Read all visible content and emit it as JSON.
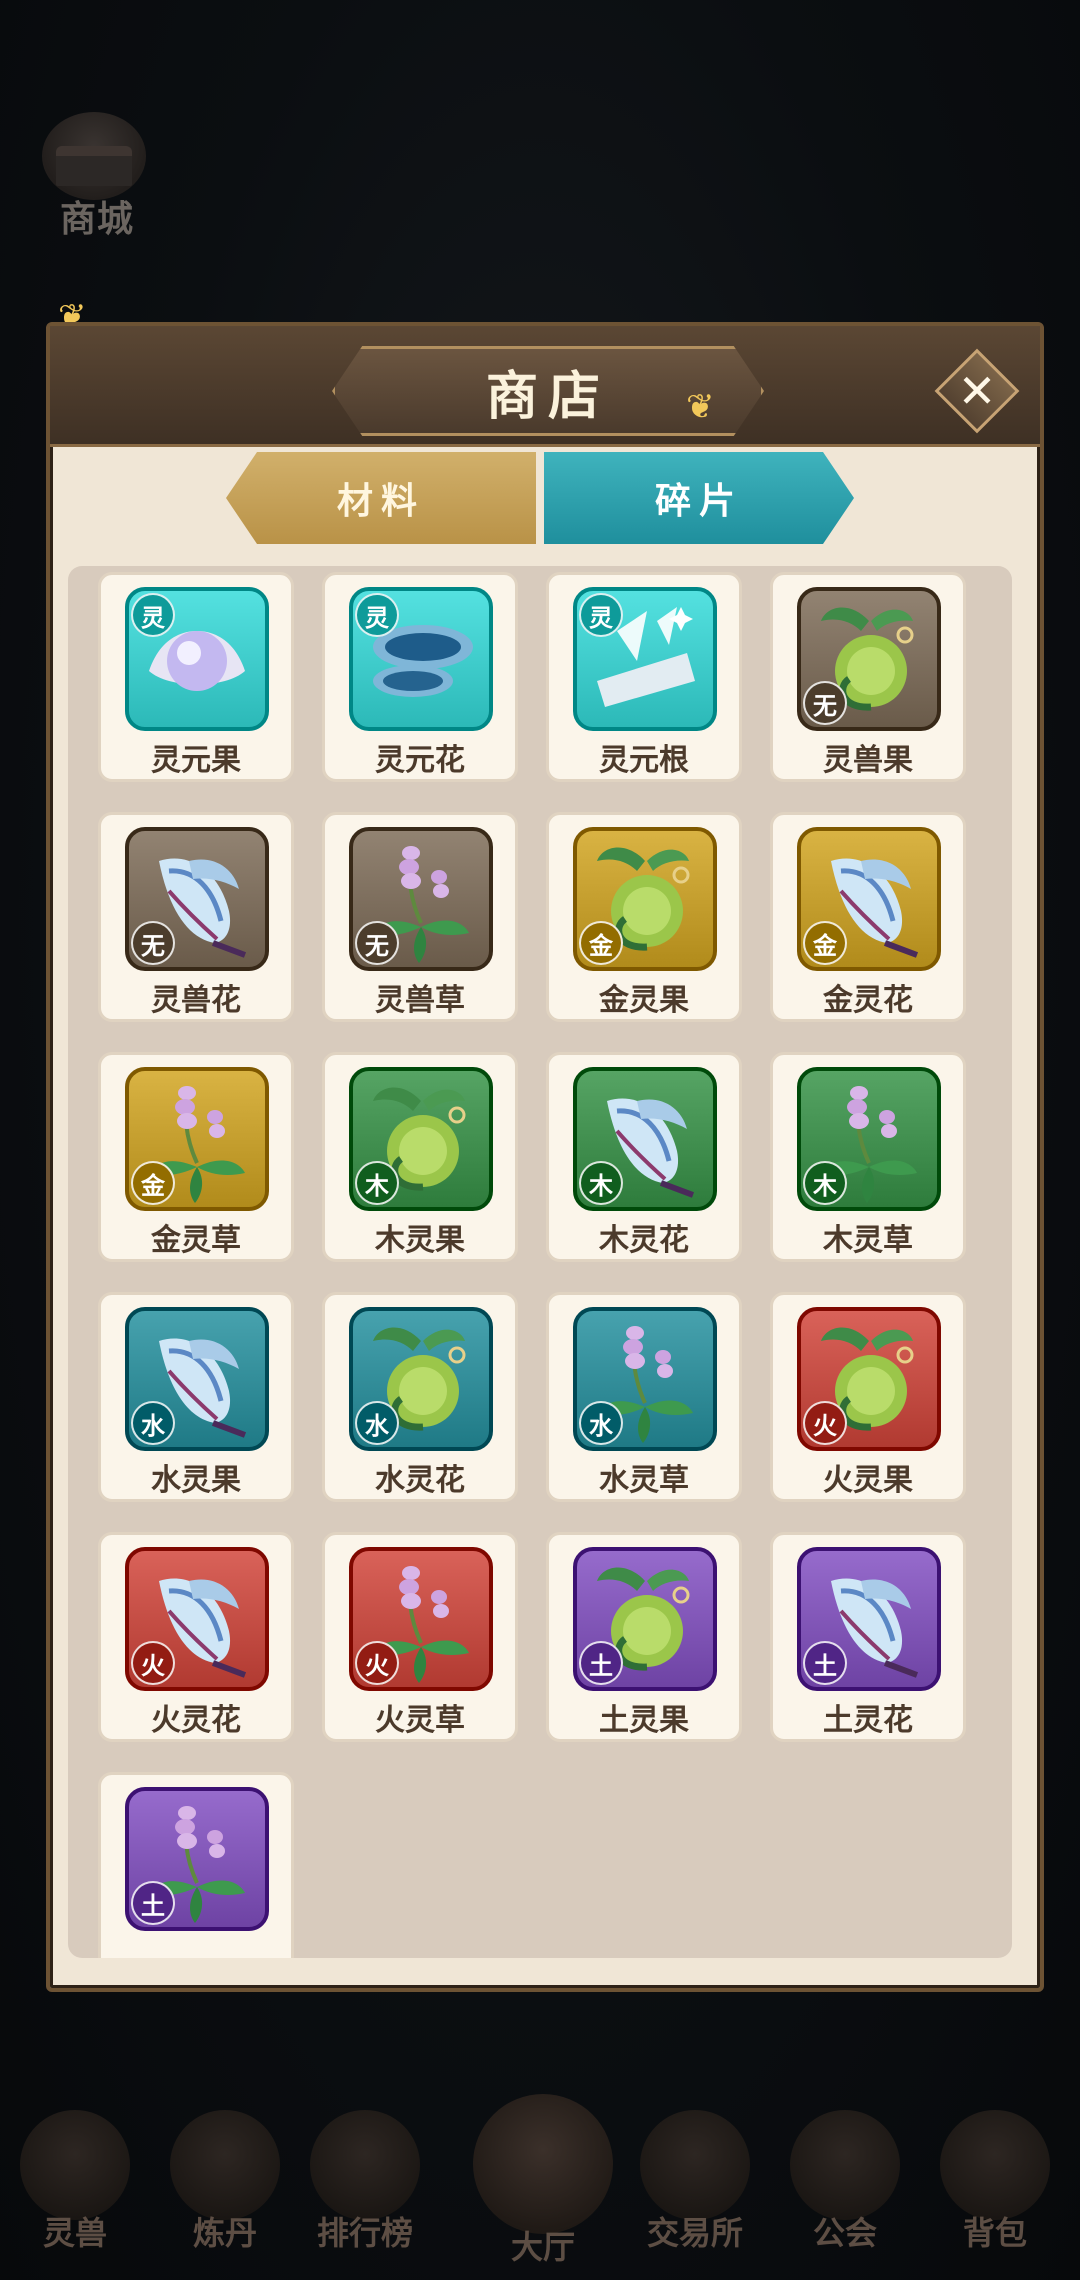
{
  "mall": {
    "label": "商城",
    "icon": "pavilion-icon"
  },
  "shop": {
    "title": "商店",
    "close_icon": "close-icon",
    "tabs": [
      {
        "label": "材料",
        "active": false
      },
      {
        "label": "碎片",
        "active": true
      }
    ]
  },
  "element_colors": {
    "灵": "#2cb9b8",
    "无": "#6a5b4a",
    "金": "#b18b1b",
    "木": "#2e7c3c",
    "水": "#1f7a86",
    "火": "#b13a31",
    "土": "#6e43a4"
  },
  "items": [
    {
      "name": "灵元果",
      "element": "灵",
      "badge_pos": "top",
      "icon": "spirit-pearl-icon"
    },
    {
      "name": "灵元花",
      "element": "灵",
      "badge_pos": "top",
      "icon": "lingzhi-mushroom-icon"
    },
    {
      "name": "灵元根",
      "element": "灵",
      "badge_pos": "top",
      "icon": "crystal-root-icon"
    },
    {
      "name": "灵兽果",
      "element": "无",
      "badge_pos": "bot",
      "icon": "spirit-fruit-icon"
    },
    {
      "name": "灵兽花",
      "element": "无",
      "badge_pos": "bot",
      "icon": "ice-flower-icon"
    },
    {
      "name": "灵兽草",
      "element": "无",
      "badge_pos": "bot",
      "icon": "lavender-herb-icon"
    },
    {
      "name": "金灵果",
      "element": "金",
      "badge_pos": "bot",
      "icon": "spirit-fruit-icon"
    },
    {
      "name": "金灵花",
      "element": "金",
      "badge_pos": "bot",
      "icon": "ice-flower-icon"
    },
    {
      "name": "金灵草",
      "element": "金",
      "badge_pos": "bot",
      "icon": "lavender-herb-icon"
    },
    {
      "name": "木灵果",
      "element": "木",
      "badge_pos": "bot",
      "icon": "spirit-fruit-icon"
    },
    {
      "name": "木灵花",
      "element": "木",
      "badge_pos": "bot",
      "icon": "ice-flower-icon"
    },
    {
      "name": "木灵草",
      "element": "木",
      "badge_pos": "bot",
      "icon": "lavender-herb-icon"
    },
    {
      "name": "水灵果",
      "element": "水",
      "badge_pos": "bot",
      "icon": "ice-flower-icon"
    },
    {
      "name": "水灵花",
      "element": "水",
      "badge_pos": "bot",
      "icon": "spirit-fruit-icon"
    },
    {
      "name": "水灵草",
      "element": "水",
      "badge_pos": "bot",
      "icon": "lavender-herb-icon"
    },
    {
      "name": "火灵果",
      "element": "火",
      "badge_pos": "bot",
      "icon": "spirit-fruit-icon"
    },
    {
      "name": "火灵花",
      "element": "火",
      "badge_pos": "bot",
      "icon": "ice-flower-icon"
    },
    {
      "name": "火灵草",
      "element": "火",
      "badge_pos": "bot",
      "icon": "lavender-herb-icon"
    },
    {
      "name": "土灵果",
      "element": "土",
      "badge_pos": "bot",
      "icon": "spirit-fruit-icon"
    },
    {
      "name": "土灵花",
      "element": "土",
      "badge_pos": "bot",
      "icon": "ice-flower-icon"
    },
    {
      "name": "",
      "element": "土",
      "badge_pos": "bot",
      "icon": "lavender-herb-icon"
    }
  ],
  "bottom_nav": [
    {
      "label": "灵兽",
      "icon": "flame-beast-icon"
    },
    {
      "label": "炼丹",
      "icon": "cauldron-icon"
    },
    {
      "label": "排行榜",
      "icon": "podium-icon"
    },
    {
      "label": "大厅",
      "icon": "hero-avatar-icon",
      "center": true
    },
    {
      "label": "交易所",
      "icon": "trade-icon"
    },
    {
      "label": "公会",
      "icon": "guild-emblem-icon"
    },
    {
      "label": "背包",
      "icon": "bag-icon"
    }
  ]
}
